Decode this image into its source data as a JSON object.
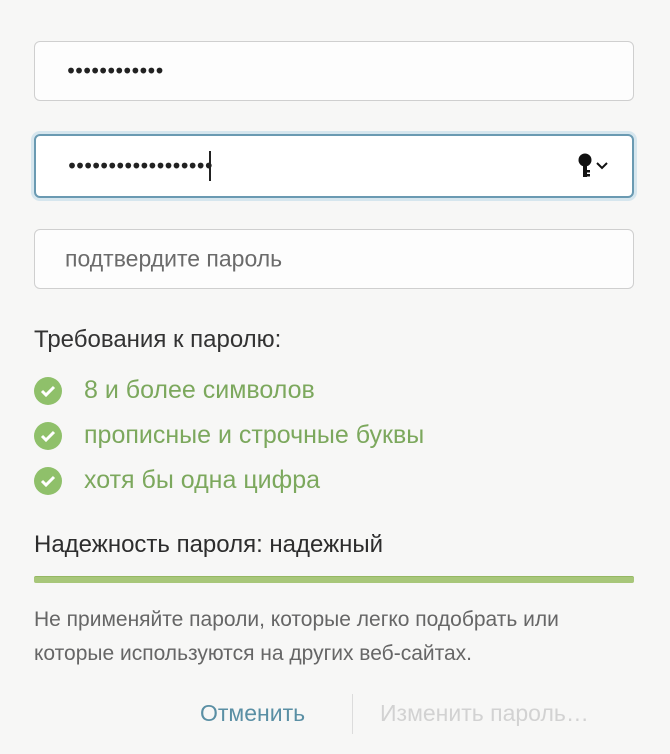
{
  "fields": {
    "password": {
      "value": "••••••••••••"
    },
    "new_password": {
      "value": "••••••••••••••••••"
    },
    "confirm": {
      "placeholder": "подтвердите пароль"
    }
  },
  "icons": {
    "key": "key-icon",
    "chevron": "chevron-down-icon",
    "check": "check-circle-icon"
  },
  "requirements": {
    "title": "Требования к паролю:",
    "items": [
      {
        "label": "8 и более символов"
      },
      {
        "label": "прописные и строчные буквы"
      },
      {
        "label": "хотя бы одна цифра"
      }
    ]
  },
  "strength": {
    "label": "Надежность пароля: надежный",
    "level": 1.0
  },
  "hint": "Не применяйте пароли, которые легко подобрать или которые используются на других веб-сайтах.",
  "buttons": {
    "cancel": "Отменить",
    "change": "Изменить пароль…"
  },
  "colors": {
    "accent_green": "#8fc06a",
    "focus_border": "#6a9ab2",
    "link": "#5a8fa4"
  }
}
